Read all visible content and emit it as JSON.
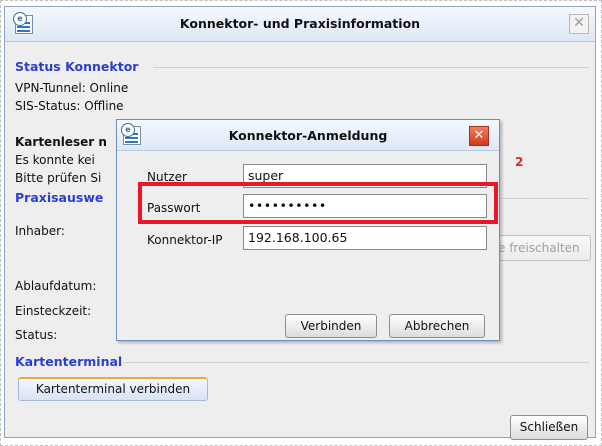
{
  "main_window": {
    "title": "Konnektor- und Praxisinformation",
    "close_symbol": "✕",
    "status_section": {
      "title": "Status Konnektor",
      "vpn": "VPN-Tunnel: Online",
      "sis": "SIS-Status: Offline"
    },
    "card_reader_section": {
      "title_partial": "Kartenleser n",
      "line1_partial": "Es konnte kei",
      "line2_partial": "Bitte prüfen Si"
    },
    "practice_section": {
      "title_partial": "Praxisauswe",
      "owner_label": "Inhaber:",
      "unlock_button_partial": "e freischalten",
      "expiry_label": "Ablaufdatum:",
      "insert_label": "Einsteckzeit:",
      "status_label": "Status:"
    },
    "terminal_section": {
      "title": "Kartenterminal",
      "connect_button": "Kartenterminal verbinden"
    },
    "close_button": "Schließen"
  },
  "dialog": {
    "title": "Konnektor-Anmeldung",
    "close_symbol": "✕",
    "user_label": "Nutzer",
    "user_value": "super",
    "password_label": "Passwort",
    "password_value": "••••••••••",
    "ip_label": "Konnektor-IP",
    "ip_value": "192.168.100.65",
    "connect_button": "Verbinden",
    "cancel_button": "Abbrechen"
  },
  "annotation": {
    "marker": "2",
    "highlight_color": "#e8182a"
  },
  "colors": {
    "section_heading": "#2a3fd1",
    "title_gradient": "#dde7f5"
  },
  "icons": [
    "app-icon",
    "close-icon"
  ]
}
